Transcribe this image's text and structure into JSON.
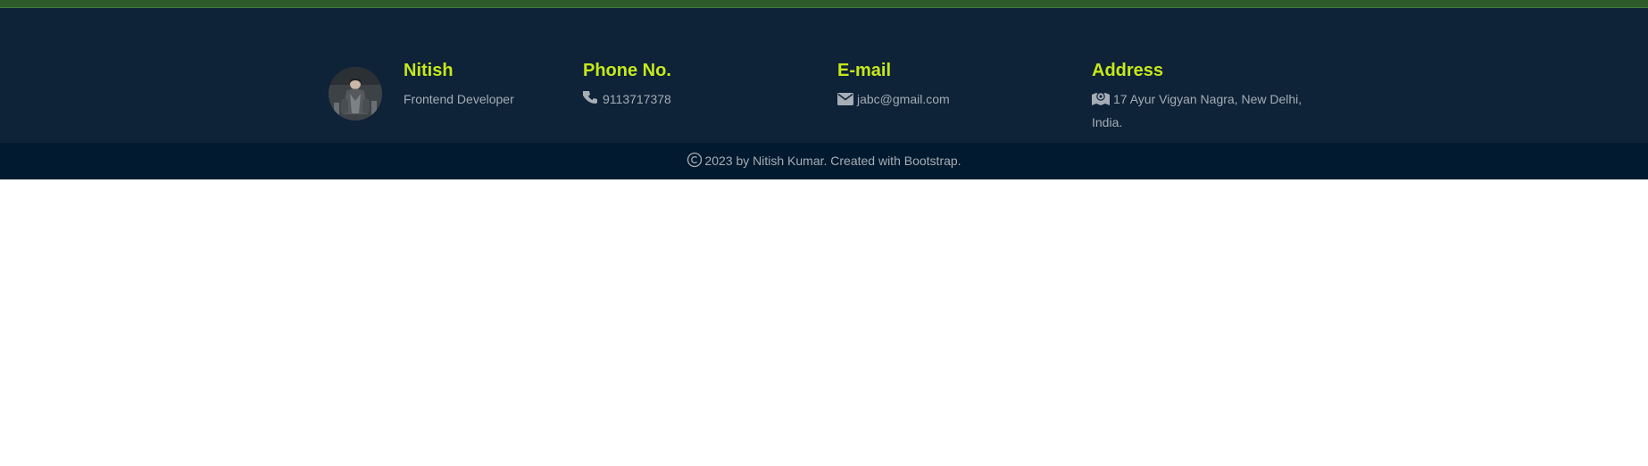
{
  "footer": {
    "profile": {
      "name": "Nitish",
      "role": "Frontend Developer"
    },
    "phone": {
      "title": "Phone No.",
      "value": "9113717378",
      "icon": "phone-icon"
    },
    "email": {
      "title": "E-mail",
      "value": "jabc@gmail.com",
      "icon": "envelope-icon"
    },
    "address": {
      "title": "Address",
      "value": "17 Ayur Vigyan Nagra, New Delhi, India.",
      "icon": "map-marker-icon"
    },
    "copyright": {
      "text": "2023 by Nitish Kumar. Created with Bootstrap.",
      "icon": "copyright-icon"
    }
  },
  "colors": {
    "accent": "#c6e81a",
    "footer_bg": "#0e2238",
    "bottom_bar_bg": "#021a2f",
    "top_strip": "#2e5a2a",
    "muted_text": "#a6adb5"
  }
}
